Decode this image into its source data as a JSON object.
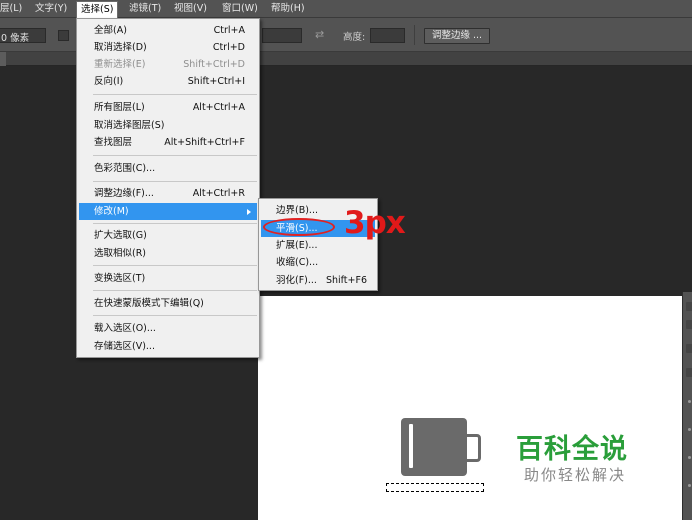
{
  "menubar": {
    "items": [
      {
        "label": "层(L)"
      },
      {
        "label": "文字(Y)"
      },
      {
        "label": "选择(S)"
      },
      {
        "label": "滤镜(T)"
      },
      {
        "label": "视图(V)"
      },
      {
        "label": "窗口(W)"
      },
      {
        "label": "帮助(H)"
      }
    ]
  },
  "options_bar": {
    "feather_value": "0 像素",
    "height_label": "高度:",
    "refine_edge_button": "调整边缘 ..."
  },
  "select_menu": {
    "items": [
      {
        "label": "全部(A)",
        "shortcut": "Ctrl+A"
      },
      {
        "label": "取消选择(D)",
        "shortcut": "Ctrl+D"
      },
      {
        "label": "重新选择(E)",
        "shortcut": "Shift+Ctrl+D"
      },
      {
        "label": "反向(I)",
        "shortcut": "Shift+Ctrl+I"
      },
      {
        "label": "所有图层(L)",
        "shortcut": "Alt+Ctrl+A"
      },
      {
        "label": "取消选择图层(S)",
        "shortcut": ""
      },
      {
        "label": "查找图层",
        "shortcut": "Alt+Shift+Ctrl+F"
      },
      {
        "label": "色彩范围(C)...",
        "shortcut": ""
      },
      {
        "label": "调整边缘(F)...",
        "shortcut": "Alt+Ctrl+R"
      },
      {
        "label": "修改(M)",
        "shortcut": ""
      },
      {
        "label": "扩大选取(G)",
        "shortcut": ""
      },
      {
        "label": "选取相似(R)",
        "shortcut": ""
      },
      {
        "label": "变换选区(T)",
        "shortcut": ""
      },
      {
        "label": "在快速蒙版模式下编辑(Q)",
        "shortcut": ""
      },
      {
        "label": "载入选区(O)...",
        "shortcut": ""
      },
      {
        "label": "存储选区(V)...",
        "shortcut": ""
      }
    ]
  },
  "modify_submenu": {
    "items": [
      {
        "label": "边界(B)...",
        "shortcut": ""
      },
      {
        "label": "平滑(S)...",
        "shortcut": ""
      },
      {
        "label": "扩展(E)...",
        "shortcut": ""
      },
      {
        "label": "收缩(C)...",
        "shortcut": ""
      },
      {
        "label": "羽化(F)...",
        "shortcut": "Shift+F6"
      }
    ]
  },
  "annotation": {
    "text": "3px",
    "color": "#e11919"
  },
  "canvas": {
    "logo_title": "百科全说",
    "logo_subtitle": "助你轻松解决"
  },
  "colors": {
    "menu_highlight": "#3295ef",
    "logo_green": "#2a9e3a",
    "app_background": "#282828"
  }
}
